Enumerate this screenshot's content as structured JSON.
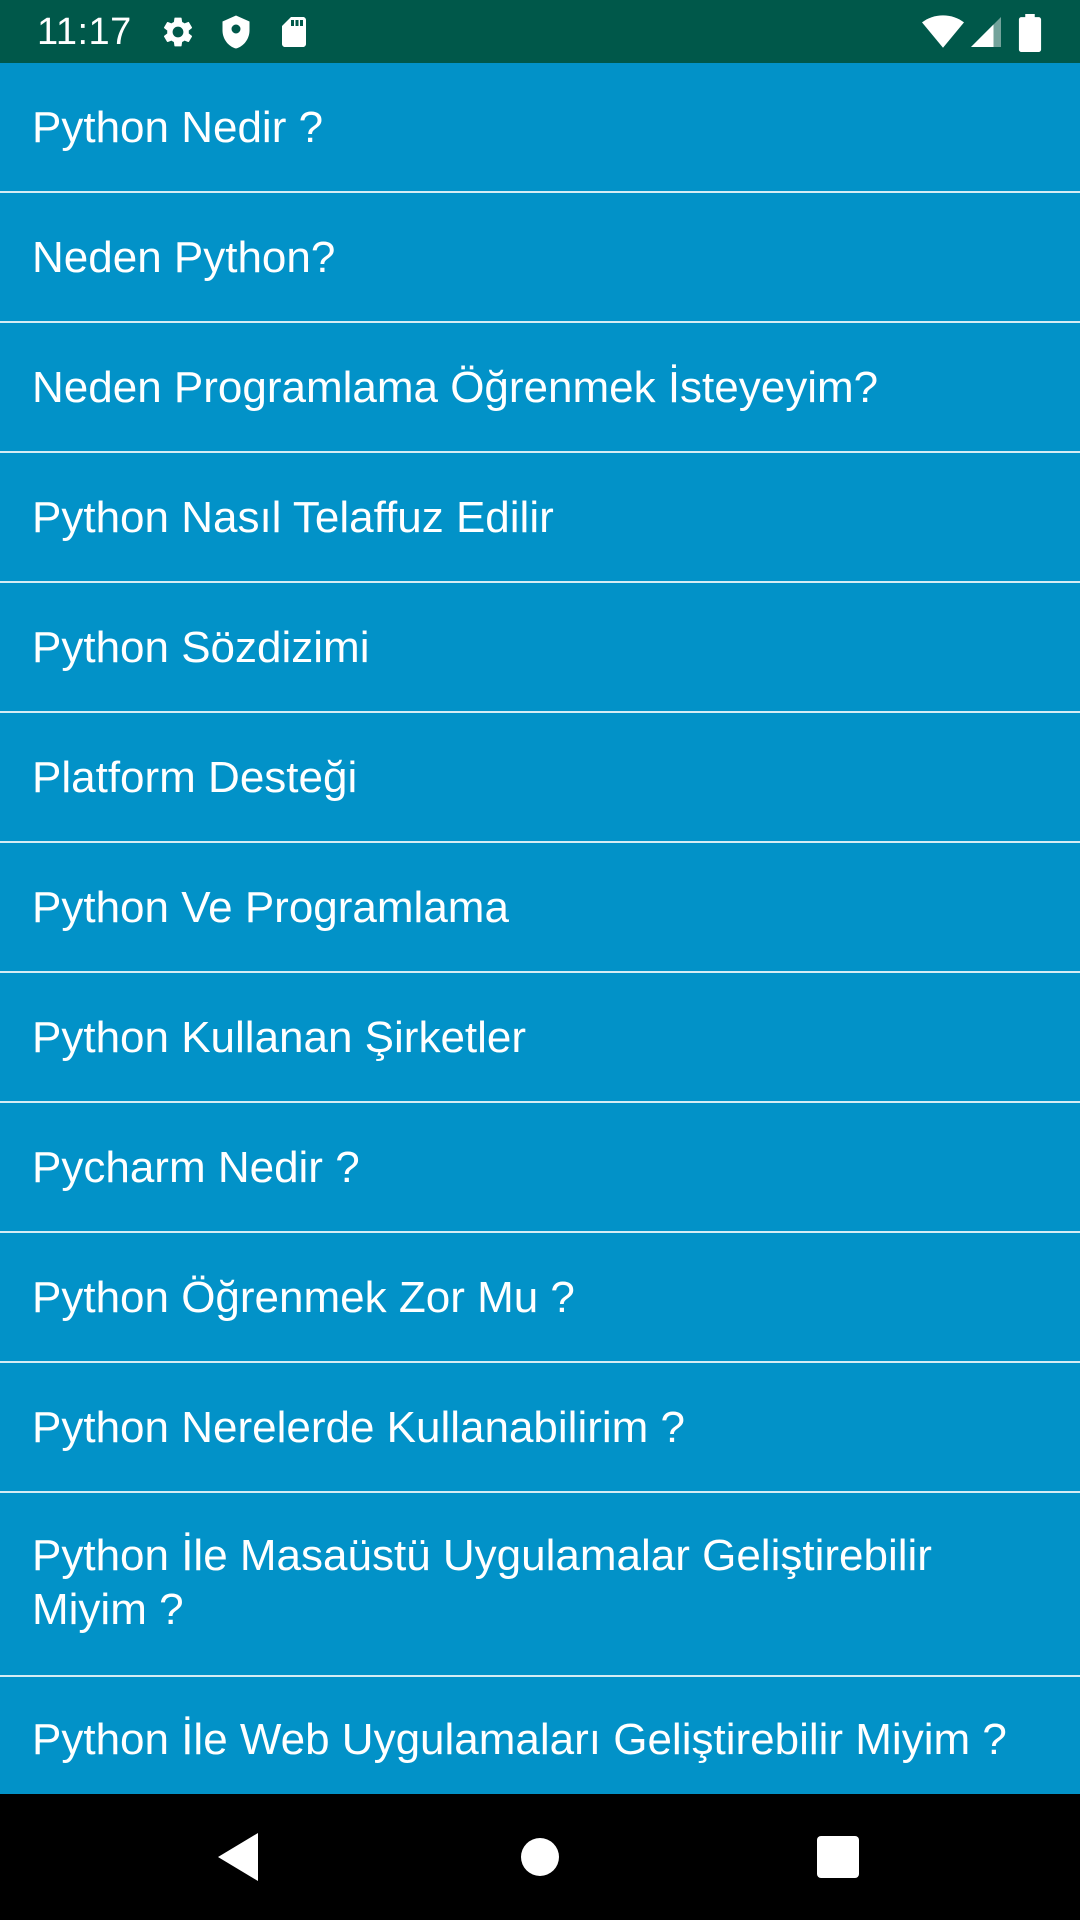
{
  "status_bar": {
    "time": "11:17",
    "left_icons": [
      "settings-icon",
      "shield-icon",
      "sd-card-icon"
    ],
    "right_icons": [
      "wifi-icon",
      "signal-icon",
      "battery-icon"
    ],
    "background": "#00584A"
  },
  "list": {
    "background": "#0292C8",
    "divider_color": "#d6ecf4",
    "items": [
      {
        "label": "Python Nedir ?"
      },
      {
        "label": "Neden Python?"
      },
      {
        "label": "Neden Programlama Öğrenmek İsteyeyim?"
      },
      {
        "label": "Python Nasıl Telaffuz Edilir"
      },
      {
        "label": "Python Sözdizimi"
      },
      {
        "label": "Platform Desteği"
      },
      {
        "label": "Python Ve Programlama"
      },
      {
        "label": "Python Kullanan Şirketler"
      },
      {
        "label": "Pycharm Nedir ?"
      },
      {
        "label": "Python Öğrenmek Zor Mu ?"
      },
      {
        "label": "Python Nerelerde Kullanabilirim ?"
      },
      {
        "label": "Python İle Masaüstü Uygulamalar Geliştirebilir Miyim ?"
      },
      {
        "label": "Python İle Web Uygulamaları Geliştirebilir Miyim ?"
      }
    ]
  },
  "nav_bar": {
    "buttons": [
      "back-icon",
      "home-icon",
      "recents-icon"
    ]
  }
}
